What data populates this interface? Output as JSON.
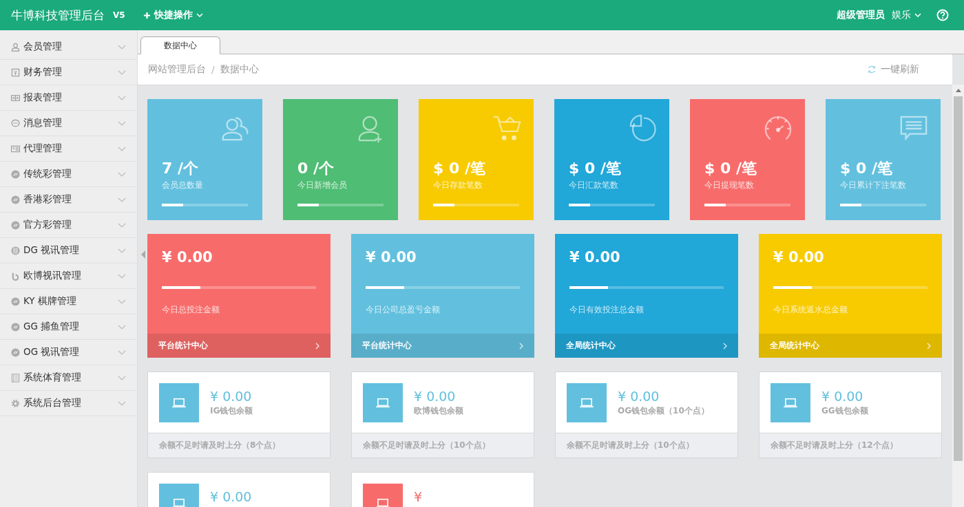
{
  "header": {
    "title": "牛博科技管理后台",
    "version": "V5",
    "quick_action": "快捷操作",
    "user": "超级管理员",
    "menu": "娱乐"
  },
  "sidebar": {
    "items": [
      {
        "label": "会员管理",
        "kind": "user"
      },
      {
        "label": "财务管理",
        "kind": "finance"
      },
      {
        "label": "报表管理",
        "kind": "report"
      },
      {
        "label": "消息管理",
        "kind": "message"
      },
      {
        "label": "代理管理",
        "kind": "agent"
      },
      {
        "label": "传统彩管理",
        "kind": "lottery"
      },
      {
        "label": "香港彩管理",
        "kind": "lottery"
      },
      {
        "label": "官方彩管理",
        "kind": "lottery"
      },
      {
        "label": "DG 视讯管理",
        "kind": "video"
      },
      {
        "label": "欧博视讯管理",
        "kind": "ob"
      },
      {
        "label": "KY 棋牌管理",
        "kind": "lottery"
      },
      {
        "label": "GG 捕鱼管理",
        "kind": "lottery"
      },
      {
        "label": "OG 视讯管理",
        "kind": "lottery"
      },
      {
        "label": "系统体育管理",
        "kind": "sports"
      },
      {
        "label": "系统后台管理",
        "kind": "gear"
      }
    ]
  },
  "tabs": [
    {
      "label": "数据中心",
      "selected": true
    }
  ],
  "breadcrumb": [
    "网站管理后台",
    "数据中心"
  ],
  "breadcrumb_separator": "/",
  "refresh": "一键刷新",
  "stats": [
    {
      "value": "7 /个",
      "label": "会员总数量",
      "color": "#62c0de",
      "kind": "users",
      "level": 0.25
    },
    {
      "value": "0 /个",
      "label": "今日新增会员",
      "color": "#4fbd74",
      "kind": "useradd",
      "level": 0.25
    },
    {
      "value": "$ 0 /笔",
      "label": "今日存款笔数",
      "color": "#f7cb00",
      "kind": "cart",
      "level": 0.25
    },
    {
      "value": "$ 0 /笔",
      "label": "今日汇款笔数",
      "color": "#21a7d8",
      "kind": "pie",
      "level": 0.25
    },
    {
      "value": "$ 0 /笔",
      "label": "今日提现笔数",
      "color": "#f76c6b",
      "kind": "gauge",
      "level": 0.25
    },
    {
      "value": "$ 0 /笔",
      "label": "今日累计下注笔数",
      "color": "#62c0de",
      "kind": "chat",
      "level": 0.25
    }
  ],
  "summaries": [
    {
      "amount": "¥ 0.00",
      "label": "今日总投注金额",
      "footer": "平台统计中心",
      "color": "#f76c6b",
      "level": 0.25
    },
    {
      "amount": "¥ 0.00",
      "label": "今日公司总盈亏金额",
      "footer": "平台统计中心",
      "color": "#62c0de",
      "level": 0.25
    },
    {
      "amount": "¥ 0.00",
      "label": "今日有效投注总金额",
      "footer": "全局统计中心",
      "color": "#21a7d8",
      "level": 0.25
    },
    {
      "amount": "¥ 0.00",
      "label": "今日系统返水总金额",
      "footer": "全局统计中心",
      "color": "#f7cb00",
      "level": 0.25
    }
  ],
  "wallets": [
    {
      "amount": "¥ 0.00",
      "label": "IG钱包余额",
      "footer": "余额不足时请及时上分（8个点）",
      "color": "#62c0de"
    },
    {
      "amount": "¥ 0.00",
      "label": "欧博钱包余额",
      "footer": "余额不足时请及时上分（10个点）",
      "color": "#62c0de"
    },
    {
      "amount": "¥ 0.00",
      "label": "OG钱包余额（10个点）",
      "footer": "余额不足时请及时上分（10个点）",
      "color": "#62c0de"
    },
    {
      "amount": "¥ 0.00",
      "label": "GG钱包余额",
      "footer": "余额不足时请及时上分（12个点）",
      "color": "#62c0de"
    },
    {
      "amount": "¥ 0.00",
      "color": "#62c0de"
    },
    {
      "amount": "¥",
      "color": "#f76c6b"
    }
  ]
}
